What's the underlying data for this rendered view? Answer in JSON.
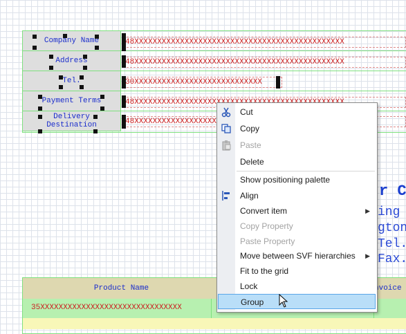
{
  "form": {
    "labels": {
      "company": "Company Name",
      "address": "Address",
      "tel": "Tel.",
      "payment": "Payment Terms",
      "delivery_line1": "Delivery",
      "delivery_line2": "Destination"
    },
    "fields": {
      "company": "48XXXXXXXXXXXXXXXXXXXXXXXXXXXXXXXXXXXXXXXXXXXXXX",
      "address": "48XXXXXXXXXXXXXXXXXXXXXXXXXXXXXXXXXXXXXXXXXXXXXX",
      "tel": "30XXXXXXXXXXXXXXXXXXXXXXXXXXXX",
      "payment": "48XXXXXXXXXXXXXXXXXXXXXXXXXXXXXXXXXXXXXXXXXXXXXX",
      "delivery": "48XXXXXXXXXXXXXXXXXXXXXXXXXXXXXXXXXXXXXXXXXXXXXX"
    }
  },
  "background_text": {
    "title_fragment": "r C",
    "lines": [
      "ing",
      "gton,",
      "Tel.",
      "Fax."
    ]
  },
  "table": {
    "headers": {
      "product": "Product Name",
      "invoice": "nvoice"
    },
    "row": {
      "product": "35XXXXXXXXXXXXXXXXXXXXXXXXXXXXXXX"
    }
  },
  "context_menu": {
    "items": [
      {
        "label": "Cut",
        "icon": "scissors-icon",
        "enabled": true
      },
      {
        "label": "Copy",
        "icon": "copy-icon",
        "enabled": true
      },
      {
        "label": "Paste",
        "icon": "paste-icon",
        "enabled": false
      },
      {
        "label": "Delete",
        "enabled": true
      },
      {
        "label": "Show positioning palette",
        "enabled": true
      },
      {
        "label": "Align",
        "icon": "align-icon",
        "enabled": true
      },
      {
        "label": "Convert item",
        "enabled": true,
        "submenu": true
      },
      {
        "label": "Copy Property",
        "enabled": false
      },
      {
        "label": "Paste Property",
        "enabled": false
      },
      {
        "label": "Move between SVF hierarchies",
        "enabled": true,
        "submenu": true
      },
      {
        "label": "Fit to the grid",
        "enabled": true
      },
      {
        "label": "Lock",
        "enabled": true
      },
      {
        "label": "Group",
        "enabled": true,
        "highlighted": true
      }
    ],
    "submenu_arrow": "▶"
  },
  "colors": {
    "label_text": "#1a2ccc",
    "field_text": "#cc1f1f",
    "grid_line": "#dde2ea",
    "selection_border": "#7ee07e",
    "menu_highlight": "#b9def8"
  }
}
